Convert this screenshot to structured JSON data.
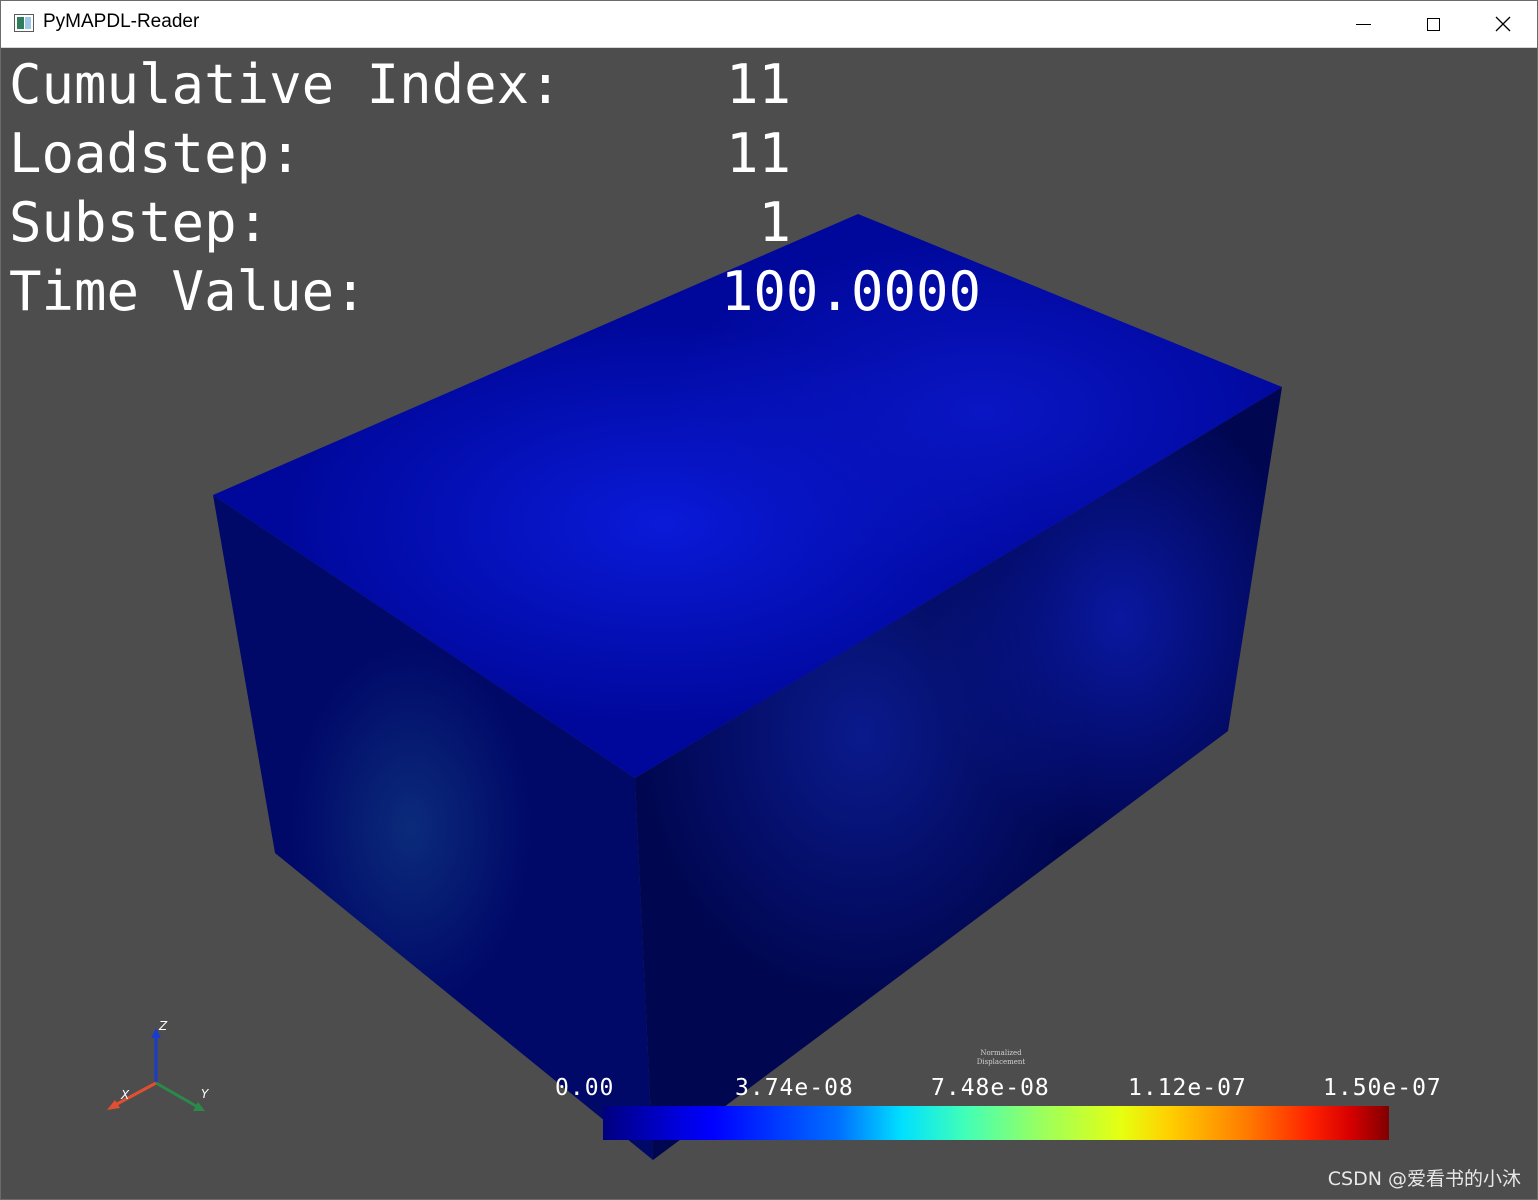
{
  "window": {
    "title": "PyMAPDL-Reader",
    "controls": [
      "minimize-icon",
      "maximize-icon",
      "close-icon"
    ]
  },
  "info": {
    "cumulative_index_label": "Cumulative Index:",
    "cumulative_index_value": "11",
    "loadstep_label": "Loadstep:",
    "loadstep_value": "11",
    "substep_label": "Substep:",
    "substep_value": "1",
    "time_value_label": "Time Value:",
    "time_value_value": "100.0000"
  },
  "scalar_bar": {
    "title": "Normalized\nDisplacement",
    "labels": [
      "0.00",
      "3.74e-08",
      "7.48e-08",
      "1.12e-07",
      "1.50e-07"
    ],
    "colormap": "jet"
  },
  "axes": {
    "x": "X",
    "y": "Y",
    "z": "Z"
  },
  "colors": {
    "background": "#4d4d4d",
    "body_base": "#000a8c",
    "axis_x": "#e05030",
    "axis_y": "#2a8a4a",
    "axis_z": "#1a3ccc"
  },
  "watermark": "CSDN @爱看书的小沐"
}
